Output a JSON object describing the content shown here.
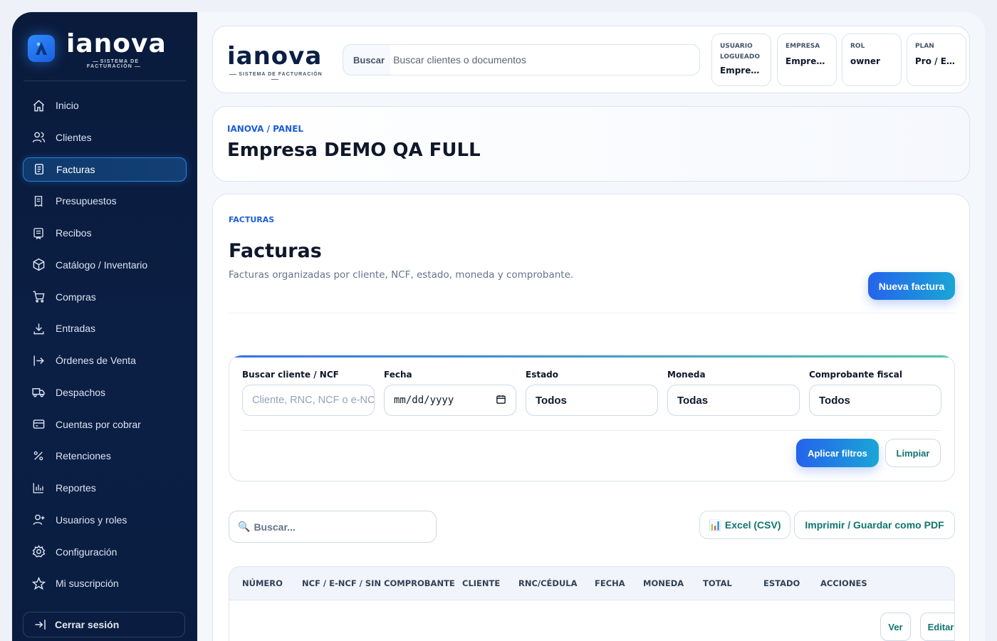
{
  "brand": {
    "name": "ianova",
    "tagline": "SISTEMA DE FACTURACIÓN"
  },
  "sidebar": {
    "items": [
      {
        "label": "Inicio",
        "icon": "home-icon"
      },
      {
        "label": "Clientes",
        "icon": "users-icon"
      },
      {
        "label": "Facturas",
        "icon": "receipt-icon",
        "active": true
      },
      {
        "label": "Presupuestos",
        "icon": "document-icon"
      },
      {
        "label": "Recibos",
        "icon": "receipt-list-icon"
      },
      {
        "label": "Catálogo / Inventario",
        "icon": "box-icon"
      },
      {
        "label": "Compras",
        "icon": "cart-icon"
      },
      {
        "label": "Entradas",
        "icon": "download-icon"
      },
      {
        "label": "Órdenes de Venta",
        "icon": "arrow-out-icon"
      },
      {
        "label": "Despachos",
        "icon": "truck-icon"
      },
      {
        "label": "Cuentas por cobrar",
        "icon": "card-icon"
      },
      {
        "label": "Retenciones",
        "icon": "percent-icon"
      },
      {
        "label": "Reportes",
        "icon": "bar-chart-icon"
      },
      {
        "label": "Usuarios y roles",
        "icon": "user-plus-icon"
      },
      {
        "label": "Configuración",
        "icon": "settings-icon"
      },
      {
        "label": "Mi suscripción",
        "icon": "star-icon"
      }
    ],
    "logout_label": "Cerrar sesión"
  },
  "topbar": {
    "search_label": "Buscar",
    "search_placeholder": "Buscar clientes o documentos",
    "cards": [
      {
        "label": "USUARIO LOGUEADO",
        "value": "Empresa DEMO QA FULL"
      },
      {
        "label": "EMPRESA",
        "value": "Empresa DEMO QA FULL"
      },
      {
        "label": "ROL",
        "value": "owner"
      },
      {
        "label": "PLAN",
        "value": "Pro / Empresa"
      }
    ]
  },
  "header": {
    "breadcrumb": "IANOVA / PANEL",
    "title": "Empresa DEMO QA FULL"
  },
  "main": {
    "kicker": "FACTURAS",
    "title": "Facturas",
    "description": "Facturas organizadas por cliente, NCF, estado, moneda y comprobante.",
    "new_button": "Nueva factura",
    "filters": {
      "search_label": "Buscar cliente / NCF",
      "search_placeholder": "Cliente, RNC, NCF o e-NCF",
      "date_label": "Fecha",
      "date_placeholder": "mm/dd/yyyy",
      "status_label": "Estado",
      "status_value": "Todos",
      "currency_label": "Moneda",
      "currency_value": "Todas",
      "fiscal_label": "Comprobante fiscal",
      "fiscal_value": "Todos",
      "apply_button": "Aplicar filtros",
      "clear_button": "Limpiar"
    },
    "table_search_placeholder": "Buscar...",
    "excel_button": "Excel (CSV)",
    "print_button": "Imprimir / Guardar como PDF",
    "columns": [
      "NÚMERO",
      "NCF / E-NCF / SIN COMPROBANTE",
      "CLIENTE",
      "RNC/CÉDULA",
      "FECHA",
      "MONEDA",
      "TOTAL",
      "ESTADO",
      "ACCIONES"
    ],
    "row_actions": [
      "Ver",
      "Editar"
    ]
  }
}
